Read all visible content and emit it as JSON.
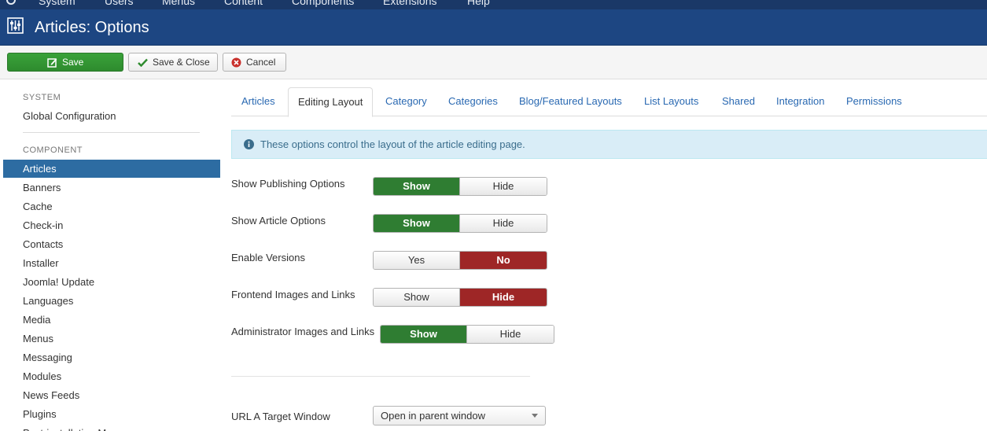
{
  "topnav": {
    "items": [
      "System",
      "Users",
      "Menus",
      "Content",
      "Components",
      "Extensions",
      "Help"
    ]
  },
  "header": {
    "title": "Articles: Options",
    "icon": "options-icon"
  },
  "toolbar": {
    "save_label": "Save",
    "save_close_label": "Save & Close",
    "cancel_label": "Cancel",
    "save_color": "#2e8b2e"
  },
  "sidebar": {
    "system_heading": "SYSTEM",
    "global_configuration": "Global Configuration",
    "component_heading": "COMPONENT",
    "items": [
      "Articles",
      "Banners",
      "Cache",
      "Check-in",
      "Contacts",
      "Installer",
      "Joomla! Update",
      "Languages",
      "Media",
      "Menus",
      "Messaging",
      "Modules",
      "News Feeds",
      "Plugins",
      "Post-installation Messages"
    ],
    "active_index": 0,
    "active_color": "#2d6ca2"
  },
  "tabs": {
    "items": [
      "Articles",
      "Editing Layout",
      "Category",
      "Categories",
      "Blog/Featured Layouts",
      "List Layouts",
      "Shared",
      "Integration",
      "Permissions"
    ],
    "active_index": 1
  },
  "alert": {
    "text": "These options control the layout of the article editing page."
  },
  "fields": [
    {
      "label": "Show Publishing Options",
      "options": [
        "Show",
        "Hide"
      ],
      "selected": "Show"
    },
    {
      "label": "Show Article Options",
      "options": [
        "Show",
        "Hide"
      ],
      "selected": "Show"
    },
    {
      "label": "Enable Versions",
      "options": [
        "Yes",
        "No"
      ],
      "selected": "No"
    },
    {
      "label": "Frontend Images and Links",
      "options": [
        "Show",
        "Hide"
      ],
      "selected": "Hide"
    },
    {
      "label": "Administrator Images and Links",
      "options": [
        "Show",
        "Hide"
      ],
      "selected": "Show"
    }
  ],
  "url_target": {
    "label": "URL A Target Window",
    "value": "Open in parent window"
  },
  "colors": {
    "positive": "#2f7d32",
    "negative": "#9e2626",
    "header_bg": "#1d4682"
  }
}
